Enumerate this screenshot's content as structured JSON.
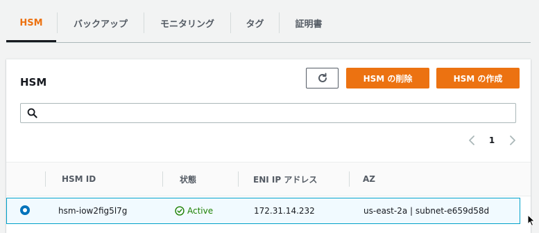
{
  "tabs": [
    {
      "label": "HSM",
      "active": true
    },
    {
      "label": "バックアップ",
      "active": false
    },
    {
      "label": "モニタリング",
      "active": false
    },
    {
      "label": "タグ",
      "active": false
    },
    {
      "label": "証明書",
      "active": false
    }
  ],
  "panel": {
    "title": "HSM",
    "delete_label": "HSM の削除",
    "create_label": "HSM の作成",
    "search_placeholder": "",
    "search_value": ""
  },
  "pagination": {
    "current_page": "1"
  },
  "table": {
    "headers": [
      "HSM ID",
      "状態",
      "ENI IP アドレス",
      "AZ"
    ],
    "rows": [
      {
        "selected": true,
        "hsm_id": "hsm-iow2fig5l7g",
        "status": "Active",
        "eni_ip": "172.31.14.232",
        "az": "us-east-2a | subnet-e659d58d"
      }
    ]
  },
  "colors": {
    "accent": "#ec7211",
    "status_success": "#1d8102",
    "selection_border": "#00a1c9",
    "radio_selected": "#0073bb"
  },
  "icons": {
    "refresh": "refresh-icon",
    "search": "search-icon",
    "prev": "chevron-left-icon",
    "next": "chevron-right-icon",
    "status": "check-circle-icon"
  }
}
